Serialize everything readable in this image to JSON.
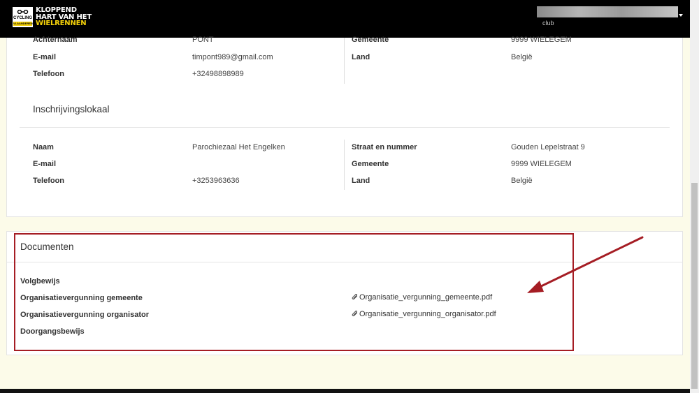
{
  "header": {
    "logo_line1": "KLOPPEND",
    "logo_line2": "HART VAN HET",
    "logo_line3": "WIELRENNEN",
    "logo_badge_text": "CYCLING",
    "logo_badge_sub": "VLAANDEREN",
    "user_sub": "club"
  },
  "organisator": {
    "rows_left": [
      {
        "label": "Achternaam",
        "value": "PONT"
      },
      {
        "label": "E-mail",
        "value": "timpont989@gmail.com"
      },
      {
        "label": "Telefoon",
        "value": "+32498898989"
      }
    ],
    "rows_right": [
      {
        "label": "Gemeente",
        "value": "9999 WIELEGEM"
      },
      {
        "label": "Land",
        "value": "België"
      }
    ]
  },
  "lokaal": {
    "title": "Inschrijvingslokaal",
    "rows_left": [
      {
        "label": "Naam",
        "value": "Parochiezaal Het Engelken"
      },
      {
        "label": "E-mail",
        "value": ""
      },
      {
        "label": "Telefoon",
        "value": "+3253963636"
      }
    ],
    "rows_right": [
      {
        "label": "Straat en nummer",
        "value": "Gouden Lepelstraat 9"
      },
      {
        "label": "Gemeente",
        "value": "9999 WIELEGEM"
      },
      {
        "label": "Land",
        "value": "België"
      }
    ]
  },
  "documenten": {
    "title": "Documenten",
    "rows": [
      {
        "label": "Volgbewijs",
        "file": ""
      },
      {
        "label": "Organisatievergunning gemeente",
        "file": "Organisatie_vergunning_gemeente.pdf"
      },
      {
        "label": "Organisatievergunning organisator",
        "file": "Organisatie_vergunning_organisator.pdf"
      },
      {
        "label": "Doorgangsbewijs",
        "file": ""
      }
    ]
  },
  "colors": {
    "highlight": "#a51d24",
    "logo_yellow": "#f5d20a"
  }
}
